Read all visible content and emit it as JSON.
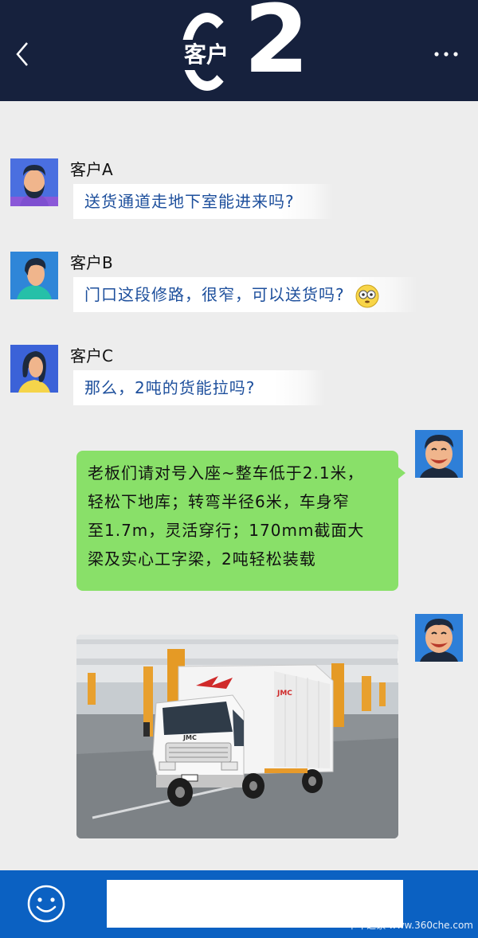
{
  "header": {
    "title": "客户",
    "deco_digit": "2",
    "back_icon": "chevron-left-icon",
    "more_icon": "more-dots-icon"
  },
  "messages": [
    {
      "sender": "客户A",
      "text": "送货通道走地下室能进来吗?"
    },
    {
      "sender": "客户B",
      "text": "门口这段修路，很窄，可以送货吗?",
      "emoji": "flushed-face-emoji"
    },
    {
      "sender": "客户C",
      "text": "那么，2吨的货能拉吗?"
    }
  ],
  "reply": {
    "lines": [
      "老板们请对号入座~整车低于2.1米，",
      "轻松下地库；转弯半径6米，车身窄",
      "至1.7m，灵活穿行；170mm截面大",
      "梁及实心工字梁，2吨轻松装载"
    ]
  },
  "truck_image": {
    "brand_text": "JMC",
    "cab_badge": "JMC"
  },
  "bottom_bar": {
    "emoji_button_icon": "smile-icon",
    "input_value": "",
    "watermark": "卡车之家 www.360che.com"
  },
  "colors": {
    "header_bg": "#16213d",
    "bottom_bar_bg": "#0b61c2",
    "reply_bubble": "#89e069",
    "customer_text": "#1d4f9c"
  }
}
